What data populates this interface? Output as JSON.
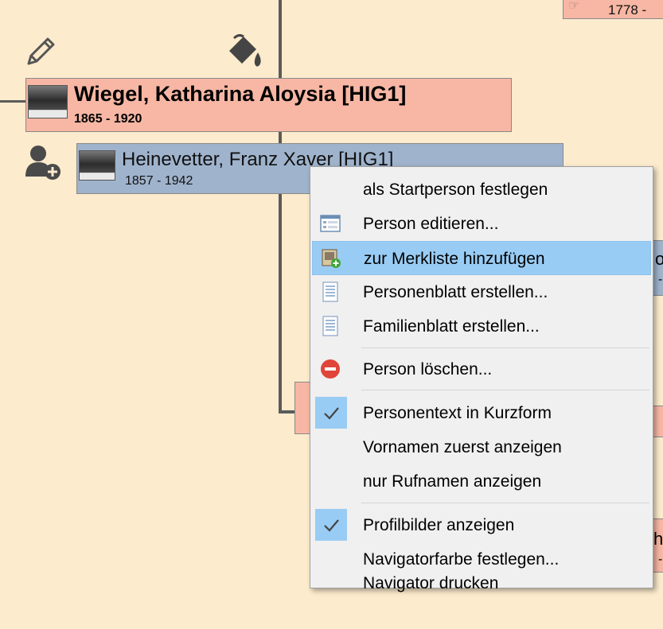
{
  "top_partial_card": {
    "years": "1778 -"
  },
  "person_main": {
    "name": "Wiegel, Katharina Aloysia [HIG1]",
    "years": "1865 - 1920"
  },
  "person_spouse": {
    "name": "Heinevetter, Franz Xaver [HIG1]",
    "years": "1857 - 1942"
  },
  "peek_texts": {
    "right_1_char": "o",
    "right_1_dash": "-",
    "right_2_char": "he",
    "right_2_dash": "-"
  },
  "context_menu": {
    "items": [
      {
        "label": "als Startperson festlegen"
      },
      {
        "label": "Person editieren..."
      },
      {
        "label": "zur Merkliste hinzufügen"
      },
      {
        "label": "Personenblatt erstellen..."
      },
      {
        "label": "Familienblatt erstellen..."
      },
      {
        "label": "Person löschen..."
      },
      {
        "label": "Personentext in Kurzform"
      },
      {
        "label": "Vornamen zuerst anzeigen"
      },
      {
        "label": "nur Rufnamen anzeigen"
      },
      {
        "label": "Profilbilder anzeigen"
      },
      {
        "label": "Navigatorfarbe festlegen..."
      },
      {
        "label": "Navigator drucken"
      }
    ]
  },
  "colors": {
    "background": "#fcebcc",
    "female_card": "#f7b7a4",
    "male_card": "#9fb3cc",
    "menu_background": "#f0f0f0",
    "menu_highlight": "#99ccf4"
  }
}
